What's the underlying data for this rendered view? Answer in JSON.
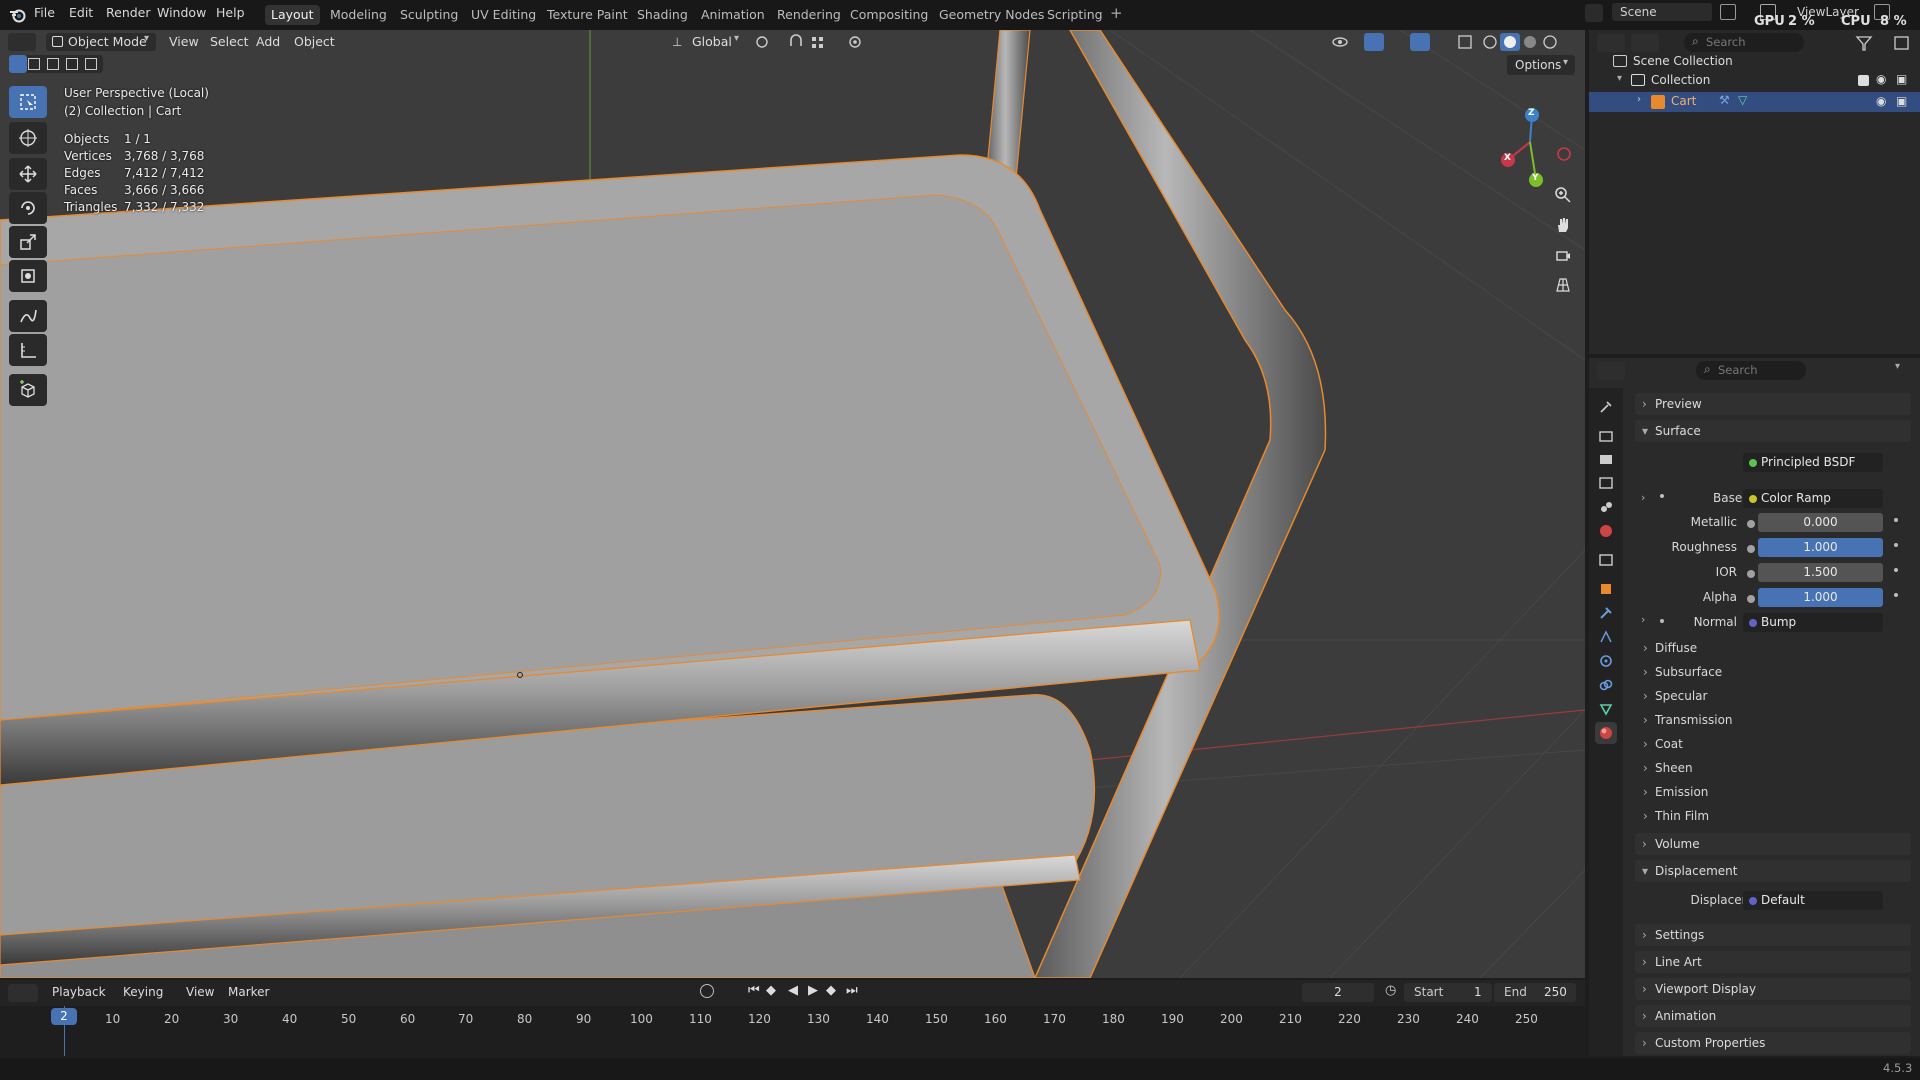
{
  "menu": {
    "items": [
      "File",
      "Edit",
      "Render",
      "Window",
      "Help"
    ]
  },
  "workspaces": [
    {
      "label": "Layout",
      "active": true
    },
    {
      "label": "Modeling"
    },
    {
      "label": "Sculpting"
    },
    {
      "label": "UV Editing"
    },
    {
      "label": "Texture Paint"
    },
    {
      "label": "Shading"
    },
    {
      "label": "Animation"
    },
    {
      "label": "Rendering"
    },
    {
      "label": "Compositing"
    },
    {
      "label": "Geometry Nodes"
    },
    {
      "label": "Scripting"
    }
  ],
  "topright": {
    "scene": "Scene",
    "viewlayer": "ViewLayer",
    "gpu_label": "GPU",
    "gpu_value": "2 %",
    "cpu_label": "CPU",
    "cpu_value": "8 %"
  },
  "viewport": {
    "mode": "Object Mode",
    "menus": [
      "View",
      "Select",
      "Add",
      "Object"
    ],
    "transform": "Global",
    "options_label": "Options",
    "view_name": "User Perspective (Local)",
    "collection_line": "(2) Collection | Cart",
    "stats": [
      {
        "label": "Objects",
        "value": "1 / 1"
      },
      {
        "label": "Vertices",
        "value": "3,768 / 3,768"
      },
      {
        "label": "Edges",
        "value": "7,412 / 7,412"
      },
      {
        "label": "Faces",
        "value": "3,666 / 3,666"
      },
      {
        "label": "Triangles",
        "value": "7,332 / 7,332"
      }
    ],
    "gizmo": {
      "x": "X",
      "y": "Y",
      "z": "Z"
    }
  },
  "outliner": {
    "search_placeholder": "Search",
    "root": "Scene Collection",
    "collection": "Collection",
    "object": "Cart"
  },
  "properties": {
    "search_placeholder": "Search",
    "preview": "Preview",
    "surface_section": "Surface",
    "surface_label": "Surface",
    "surface_value": "Principled BSDF",
    "basecolor_label": "Base Co...",
    "basecolor_value": "Color Ramp",
    "metallic_label": "Metallic",
    "metallic_value": "0.000",
    "roughness_label": "Roughness",
    "roughness_value": "1.000",
    "ior_label": "IOR",
    "ior_value": "1.500",
    "alpha_label": "Alpha",
    "alpha_value": "1.000",
    "normal_label": "Normal",
    "normal_value": "Bump",
    "subpanels": [
      "Diffuse",
      "Subsurface",
      "Specular",
      "Transmission",
      "Coat",
      "Sheen",
      "Emission",
      "Thin Film"
    ],
    "volume": "Volume",
    "displacement_section": "Displacement",
    "displacement_label": "Displacement",
    "displacement_value": "Default",
    "settings": "Settings",
    "line_art": "Line Art",
    "viewport_display": "Viewport Display",
    "animation": "Animation",
    "custom_properties": "Custom Properties"
  },
  "timeline": {
    "menus": [
      "Playback",
      "Keying",
      "View",
      "Marker"
    ],
    "current_frame": "2",
    "start_label": "Start",
    "start": "1",
    "end_label": "End",
    "end": "250",
    "ticks": [
      "2",
      "10",
      "20",
      "30",
      "40",
      "50",
      "60",
      "70",
      "80",
      "90",
      "100",
      "110",
      "120",
      "130",
      "140",
      "150",
      "160",
      "170",
      "180",
      "190",
      "200",
      "210",
      "220",
      "230",
      "240",
      "250"
    ]
  },
  "status": {
    "version": "4.5.3"
  },
  "colors": {
    "accent": "#4772b3",
    "selection": "#e8892e",
    "background": "#3c3c3c"
  }
}
